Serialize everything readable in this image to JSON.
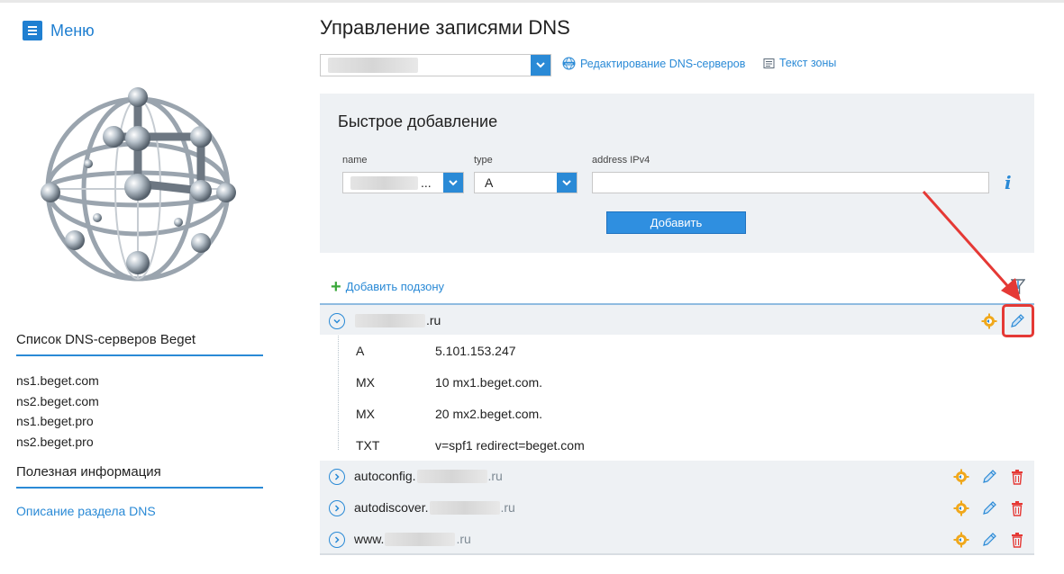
{
  "sidebar": {
    "menu_label": "Меню",
    "servers_title": "Список DNS-серверов Beget",
    "servers": [
      "ns1.beget.com",
      "ns2.beget.com",
      "ns1.beget.pro",
      "ns2.beget.pro"
    ],
    "info_title": "Полезная информация",
    "info_link": "Описание раздела DNS"
  },
  "header": {
    "title": "Управление записями DNS",
    "edit_dns_link": "Редактирование DNS-серверов",
    "zone_text_link": "Текст зоны"
  },
  "quick_add": {
    "title": "Быстрое добавление",
    "name_label": "name",
    "name_suffix": "...",
    "type_label": "type",
    "type_value": "A",
    "address_label": "address IPv4",
    "address_value": "",
    "info_icon": "i",
    "submit_label": "Добавить"
  },
  "add_subzone_label": "Добавить подзону",
  "zones": [
    {
      "prefix": "",
      "tld": ".ru",
      "expanded": true,
      "records": [
        {
          "type": "A",
          "value": "5.101.153.247"
        },
        {
          "type": "MX",
          "value": "10 mx1.beget.com."
        },
        {
          "type": "MX",
          "value": "20 mx2.beget.com."
        },
        {
          "type": "TXT",
          "value": "v=spf1 redirect=beget.com"
        }
      ]
    },
    {
      "prefix": "autoconfig.",
      "tld": ".ru",
      "expanded": false
    },
    {
      "prefix": "autodiscover.",
      "tld": ".ru",
      "expanded": false
    },
    {
      "prefix": "www.",
      "tld": ".ru",
      "expanded": false
    }
  ],
  "colors": {
    "accent": "#2a8ad6",
    "highlight": "#e53935",
    "panel": "#eef1f4"
  }
}
